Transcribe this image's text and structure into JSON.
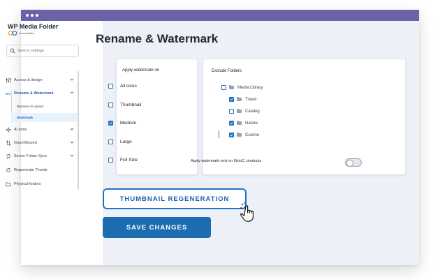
{
  "app": {
    "brand": "WP Media Folder",
    "sub_brand": "JoomUnited"
  },
  "search": {
    "placeholder": "Search settings"
  },
  "sidebar": {
    "items": [
      {
        "label": "Access & design",
        "icon": "sliders-icon"
      },
      {
        "label": "Rename & Watermark",
        "icon": "rename-icon"
      },
      {
        "label": "AI tools",
        "icon": "sparkle-icon"
      },
      {
        "label": "Import/Export",
        "icon": "import-export-icon"
      },
      {
        "label": "Server Folder Sync",
        "icon": "sync-icon"
      },
      {
        "label": "Regenerate Thumb",
        "icon": "refresh-icon"
      },
      {
        "label": "Physical folders",
        "icon": "folder-icon"
      }
    ],
    "subitems": [
      {
        "label": "Rename on upload"
      },
      {
        "label": "Watermark"
      }
    ]
  },
  "page": {
    "title": "Rename & Watermark"
  },
  "watermark": {
    "title": "Apply watermark on",
    "options": [
      {
        "label": "All sizes",
        "checked": false
      },
      {
        "label": "Thumbnail",
        "checked": false
      },
      {
        "label": "Medium",
        "checked": true
      },
      {
        "label": "Large",
        "checked": false
      },
      {
        "label": "Full Size",
        "checked": false
      }
    ]
  },
  "exclude": {
    "title": "Exclude Folders",
    "root": {
      "label": "Media Library",
      "checked": false
    },
    "folders": [
      {
        "label": "Travel",
        "checked": true
      },
      {
        "label": "Catalog",
        "checked": false
      },
      {
        "label": "Nature",
        "checked": true
      },
      {
        "label": "Cuisine",
        "checked": true
      }
    ],
    "wooc_label": "Apply watermark only on WooC. products",
    "wooc_enabled": false
  },
  "buttons": {
    "regenerate": "THUMBNAIL REGENERATION",
    "save": "SAVE CHANGES"
  },
  "colors": {
    "titlebar": "#6b63a8",
    "accent": "#1e74c6",
    "save_button": "#1b6cb0",
    "main_bg": "#eef0f8"
  }
}
